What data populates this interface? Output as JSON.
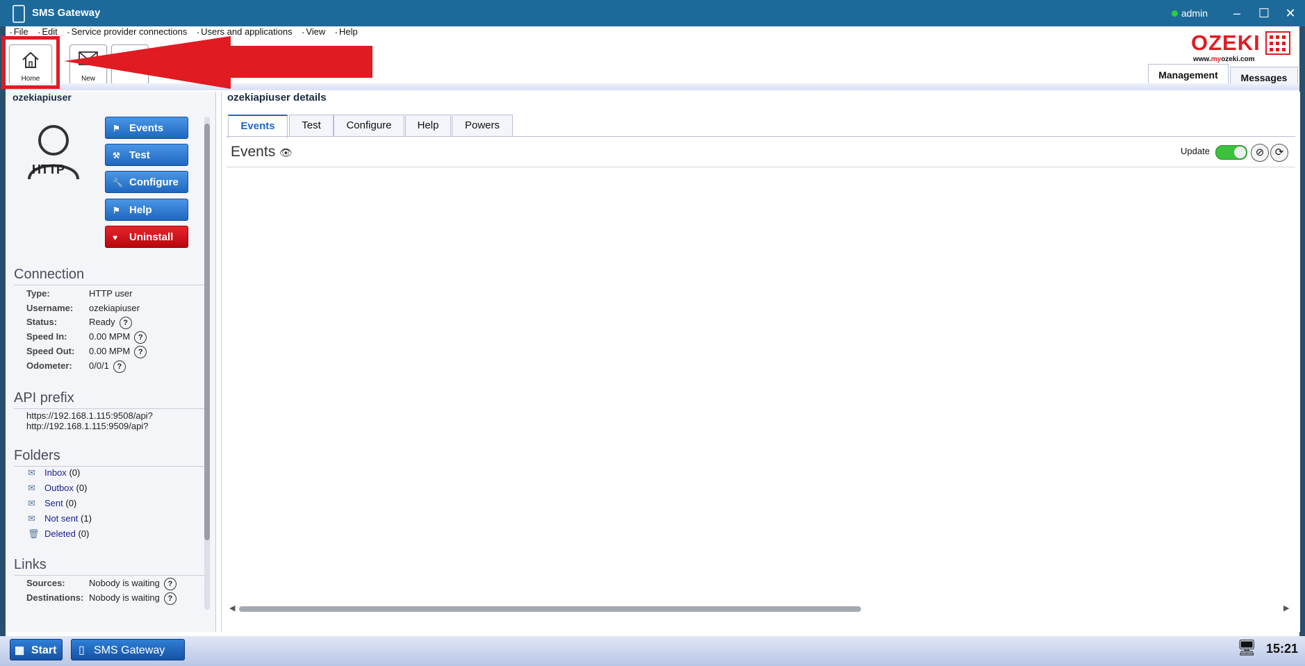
{
  "titlebar": {
    "title": "SMS Gateway",
    "user": "admin",
    "minimize": "–",
    "maximize": "☐",
    "close": "✕"
  },
  "menu": [
    "File",
    "Edit",
    "Service provider connections",
    "Users and applications",
    "View",
    "Help"
  ],
  "toolbar": {
    "home": "Home",
    "new": "New"
  },
  "logo": {
    "text": "OZEKI",
    "url_pre": "www.",
    "url_brand": "my",
    "url_post": "ozeki.com"
  },
  "top_tabs": [
    "Management",
    "Messages"
  ],
  "left": {
    "user_title": "ozekiapiuser",
    "avatar_label": "HTTP",
    "buttons": [
      "Events",
      "Test",
      "Configure",
      "Help",
      "Uninstall"
    ],
    "connection": {
      "heading": "Connection",
      "rows": [
        {
          "k": "Type:",
          "v": "HTTP user"
        },
        {
          "k": "Username:",
          "v": "ozekiapiuser"
        },
        {
          "k": "Status:",
          "v": "Ready"
        },
        {
          "k": "Speed In:",
          "v": "0.00 MPM"
        },
        {
          "k": "Speed Out:",
          "v": "0.00 MPM"
        },
        {
          "k": "Odometer:",
          "v": "0/0/1"
        }
      ]
    },
    "api": {
      "heading": "API prefix",
      "lines": [
        "https://192.168.1.115:9508/api?",
        "http://192.168.1.115:9509/api?"
      ]
    },
    "folders": {
      "heading": "Folders",
      "items": [
        {
          "name": "Inbox",
          "count": "(0)"
        },
        {
          "name": "Outbox",
          "count": "(0)"
        },
        {
          "name": "Sent",
          "count": "(0)"
        },
        {
          "name": "Not sent",
          "count": "(1)"
        },
        {
          "name": "Deleted",
          "count": "(0)"
        }
      ]
    },
    "links": {
      "heading": "Links",
      "rows": [
        {
          "k": "Sources:",
          "v": "Nobody is waiting"
        },
        {
          "k": "Destinations:",
          "v": "Nobody is waiting"
        }
      ]
    }
  },
  "right": {
    "title": "ozekiapiuser details",
    "tabs": [
      "Events",
      "Test",
      "Configure",
      "Help",
      "Powers"
    ],
    "events_heading": "Events",
    "update_label": "Update"
  },
  "taskbar": {
    "start": "Start",
    "app": "SMS Gateway",
    "time": "15:21"
  },
  "colors": {
    "titlebar": "#1d6a9a",
    "button_blue": "#1e67c0",
    "button_red": "#d0121a",
    "annotation_red": "#e01b22"
  }
}
